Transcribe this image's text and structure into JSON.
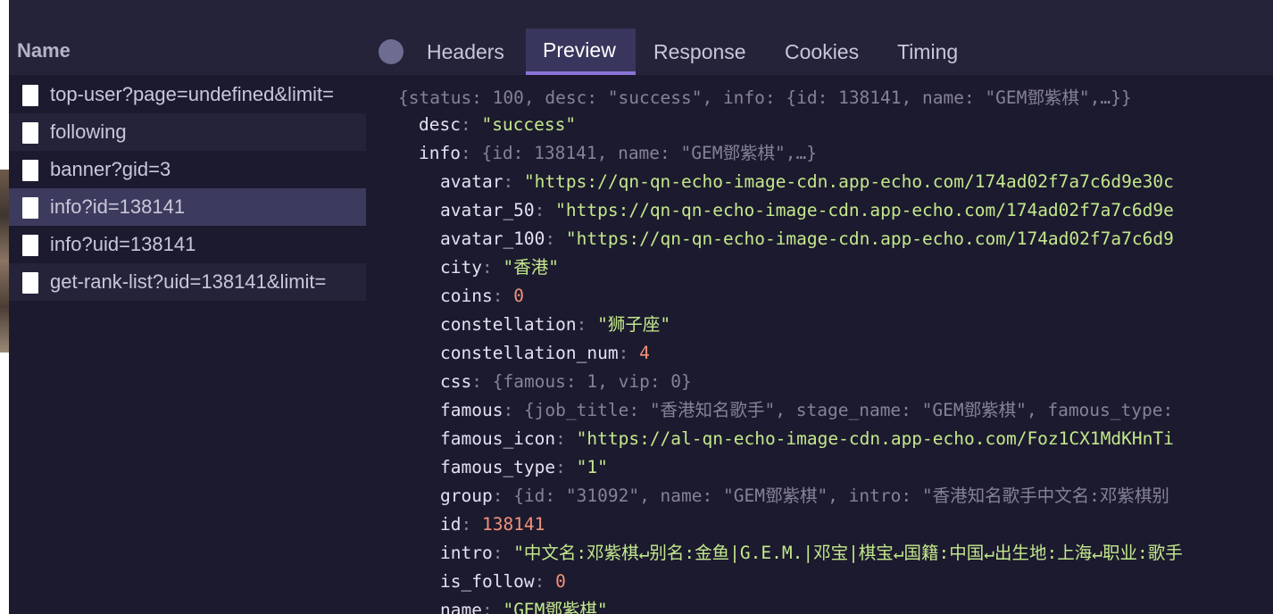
{
  "columns": {
    "name": "Name"
  },
  "tabs": [
    "Headers",
    "Preview",
    "Response",
    "Cookies",
    "Timing"
  ],
  "active_tab": "Preview",
  "requests": [
    "top-user?page=undefined&limit=",
    "following",
    "banner?gid=3",
    "info?id=138141",
    "info?uid=138141",
    "get-rank-list?uid=138141&limit="
  ],
  "selected_request": "info?id=138141",
  "preview": {
    "summary": "{status: 100, desc: \"success\", info: {id: 138141, name: \"GEM鄧紫棋\",…}}",
    "entries": [
      {
        "key": "desc",
        "value": "\"success\"",
        "kind": "string"
      },
      {
        "key": "info",
        "value": "{id: 138141, name: \"GEM鄧紫棋\",…}",
        "kind": "object"
      },
      {
        "key": "avatar",
        "value": "\"https://qn-qn-echo-image-cdn.app-echo.com/174ad02f7a7c6d9e30c",
        "kind": "string"
      },
      {
        "key": "avatar_50",
        "value": "\"https://qn-qn-echo-image-cdn.app-echo.com/174ad02f7a7c6d9e",
        "kind": "string"
      },
      {
        "key": "avatar_100",
        "value": "\"https://qn-qn-echo-image-cdn.app-echo.com/174ad02f7a7c6d9",
        "kind": "string"
      },
      {
        "key": "city",
        "value": "\"香港\"",
        "kind": "string"
      },
      {
        "key": "coins",
        "value": "0",
        "kind": "number"
      },
      {
        "key": "constellation",
        "value": "\"狮子座\"",
        "kind": "string"
      },
      {
        "key": "constellation_num",
        "value": "4",
        "kind": "number"
      },
      {
        "key": "css",
        "value": "{famous: 1, vip: 0}",
        "kind": "object"
      },
      {
        "key": "famous",
        "value": "{job_title: \"香港知名歌手\", stage_name: \"GEM鄧紫棋\", famous_type:",
        "kind": "object"
      },
      {
        "key": "famous_icon",
        "value": "\"https://al-qn-echo-image-cdn.app-echo.com/Foz1CX1MdKHnTi",
        "kind": "string"
      },
      {
        "key": "famous_type",
        "value": "\"1\"",
        "kind": "string"
      },
      {
        "key": "group",
        "value": "{id: \"31092\", name: \"GEM鄧紫棋\", intro: \"香港知名歌手中文名:邓紫棋别",
        "kind": "object"
      },
      {
        "key": "id",
        "value": "138141",
        "kind": "number"
      },
      {
        "key": "intro",
        "value": "\"中文名:邓紫棋↵别名:金鱼|G.E.M.|邓宝|棋宝↵国籍:中国↵出生地:上海↵职业:歌手",
        "kind": "string"
      },
      {
        "key": "is_follow",
        "value": "0",
        "kind": "number"
      },
      {
        "key": "name",
        "value": "\"GEM鄧紫棋\"",
        "kind": "string"
      }
    ]
  },
  "colors": {
    "background": "#1c1a2e",
    "header": "#242339",
    "selected_row": "#3c3b5e",
    "tab_underline": "#8b74d8",
    "string": "#c3e88d",
    "number": "#f2917b",
    "key": "#e3e1f2",
    "muted": "#858298"
  }
}
